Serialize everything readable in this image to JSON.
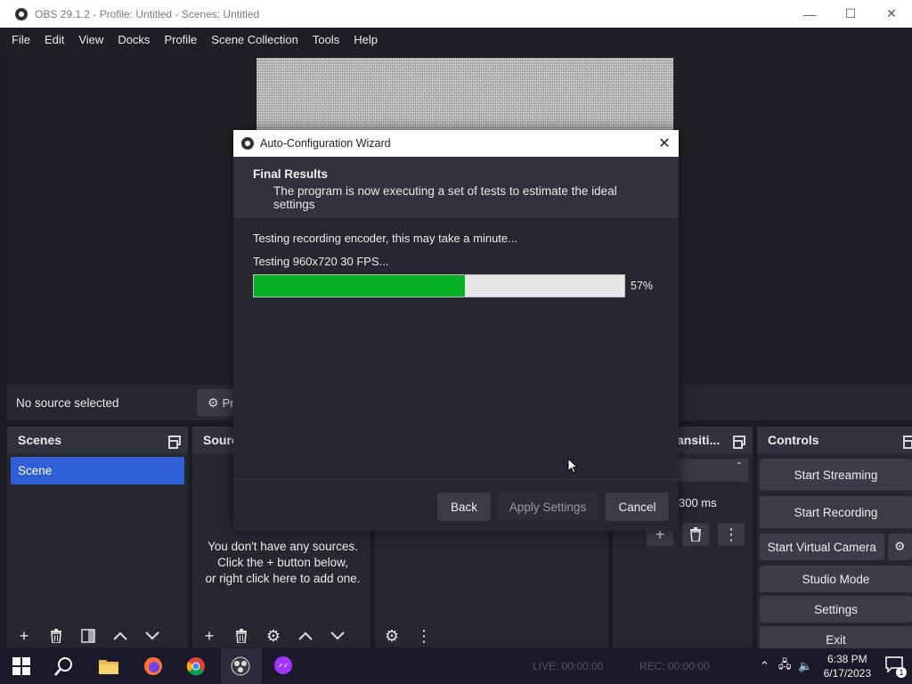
{
  "window": {
    "title": "OBS 29.1.2 - Profile: Untitled - Scenes: Untitled",
    "minimize": "—",
    "maximize": "☐",
    "close": "✕"
  },
  "menu": [
    "File",
    "Edit",
    "View",
    "Docks",
    "Profile",
    "Scene Collection",
    "Tools",
    "Help"
  ],
  "source_toolbar": {
    "no_source": "No source selected",
    "properties_label": "Pr"
  },
  "docks": {
    "scenes": {
      "title": "Scenes",
      "items": [
        "Scene"
      ]
    },
    "sources": {
      "title": "Sourc",
      "empty_line1": "You don't have any sources.",
      "empty_line2": "Click the + button below,",
      "empty_line3": "or right click here to add one."
    },
    "transitions": {
      "title": "ansiti...",
      "duration": "300 ms"
    },
    "controls": {
      "title": "Controls",
      "buttons": [
        "Start Streaming",
        "Start Recording",
        "Start Virtual Camera",
        "Studio Mode",
        "Settings",
        "Exit"
      ]
    }
  },
  "dialog": {
    "title": "Auto-Configuration Wizard",
    "close": "✕",
    "heading": "Final Results",
    "subheading": "The program is now executing a set of tests to estimate the ideal settings",
    "status": "Testing recording encoder, this may take a minute...",
    "test": "Testing 960x720 30 FPS...",
    "progress": 57,
    "progress_label": "57%",
    "buttons": {
      "back": "Back",
      "apply": "Apply Settings",
      "cancel": "Cancel"
    }
  },
  "status_bar": {
    "live": "LIVE: 00:00:00",
    "rec": "REC: 00:00:00"
  },
  "taskbar": {
    "time": "6:38 PM",
    "date": "6/17/2023",
    "notification_count": "1"
  }
}
